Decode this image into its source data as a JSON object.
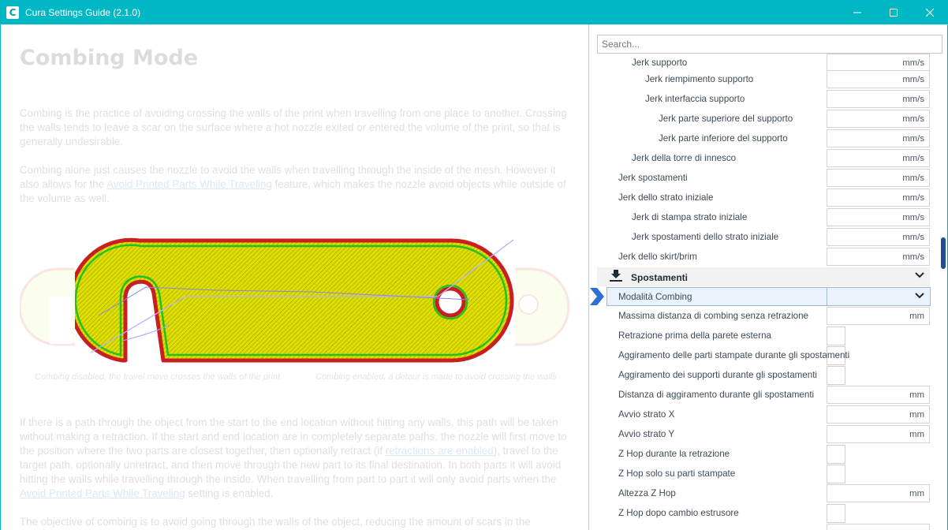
{
  "window": {
    "app_icon": "C",
    "title": "Cura Settings Guide (2.1.0)",
    "controls": [
      "minimize-icon",
      "maximize-icon",
      "close-icon"
    ]
  },
  "article": {
    "title": "Combing Mode",
    "p1": "Combing is the practice of avoiding crossing the walls of the print when travelling from one place to another. Crossing the walls tends to leave a scar on the surface where a hot nozzle exited or entered the volume of the print, so that is generally undesirable.",
    "p2_before": "Combing alone just causes the nozzle to avoid the walls when travelling through the inside of the mesh. However it also allows for the ",
    "p2_link": "Avoid Printed Parts While Traveling",
    "p2_after": " feature, which makes the nozzle avoid objects while outside of the volume as well.",
    "caption_left": "Combing disabled, the travel move crosses the walls of the print",
    "caption_right": "Combing enabled, a detour is made to avoid crossing the walls",
    "p3_before": "If there is a path through the object from the start to the end location without hitting any walls, this path will be taken without making a retraction. If the start and end location are in completely separate paths, the nozzle will first move to the position where the two parts are closest together, then optionally retract (if ",
    "p3_link1": "retractions are enabled",
    "p3_mid": "), travel to the target path, optionally unretract, and then move through the new part to its final destination. In both parts it will avoid hitting the walls while travelling through the inside. When travelling from part to part it will only avoid parts when the ",
    "p3_link2": "Avoid Printed Parts While Traveling",
    "p3_after": " setting is enabled.",
    "p4": "The objective of combing is to avoid going through the walls of the object, reducing the amount of scars in the"
  },
  "panel": {
    "search_placeholder": "Search...",
    "rows_top": [
      {
        "label": "Jerk supporto",
        "unit": "mm/s"
      },
      {
        "label": "Jerk riempimento supporto",
        "unit": "mm/s"
      },
      {
        "label": "Jerk interfaccia supporto",
        "unit": "mm/s"
      },
      {
        "label": "Jerk parte superiore del supporto",
        "unit": "mm/s"
      },
      {
        "label": "Jerk parte inferiore del supporto",
        "unit": "mm/s"
      },
      {
        "label": "Jerk della torre di innesco",
        "unit": "mm/s"
      },
      {
        "label": "Jerk spostamenti",
        "unit": "mm/s"
      },
      {
        "label": "Jerk dello strato iniziale",
        "unit": "mm/s"
      },
      {
        "label": "Jerk di stampa strato iniziale",
        "unit": "mm/s"
      },
      {
        "label": "Jerk spostamenti dello strato iniziale",
        "unit": "mm/s"
      },
      {
        "label": "Jerk dello skirt/brim",
        "unit": "mm/s"
      }
    ],
    "category": {
      "label": "Spostamenti",
      "icon": "travel-icon"
    },
    "combing": {
      "label": "Modalità Combing"
    },
    "rows_bottom": [
      {
        "label": "Massima distanza di combing senza retrazione",
        "unit": "mm"
      },
      {
        "label": "Retrazione prima della parete esterna",
        "unit": ""
      },
      {
        "label": "Aggiramento delle parti stampate durante gli spostamenti",
        "unit": ""
      },
      {
        "label": "Aggiramento dei supporti durante gli spostamenti",
        "unit": ""
      },
      {
        "label": "Distanza di aggiramento durante gli spostamenti",
        "unit": "mm"
      },
      {
        "label": "Avvio strato X",
        "unit": "mm"
      },
      {
        "label": "Avvio strato Y",
        "unit": "mm"
      },
      {
        "label": "Z Hop durante la retrazione",
        "unit": ""
      },
      {
        "label": "Z Hop solo su parti stampate",
        "unit": ""
      },
      {
        "label": "Altezza Z Hop",
        "unit": "mm"
      },
      {
        "label": "Z Hop dopo cambio estrusore",
        "unit": ""
      }
    ]
  },
  "colors": {
    "titlebar": "#00b8c4",
    "accent": "#1e4f8f",
    "pointer": "#2f6fd1"
  }
}
